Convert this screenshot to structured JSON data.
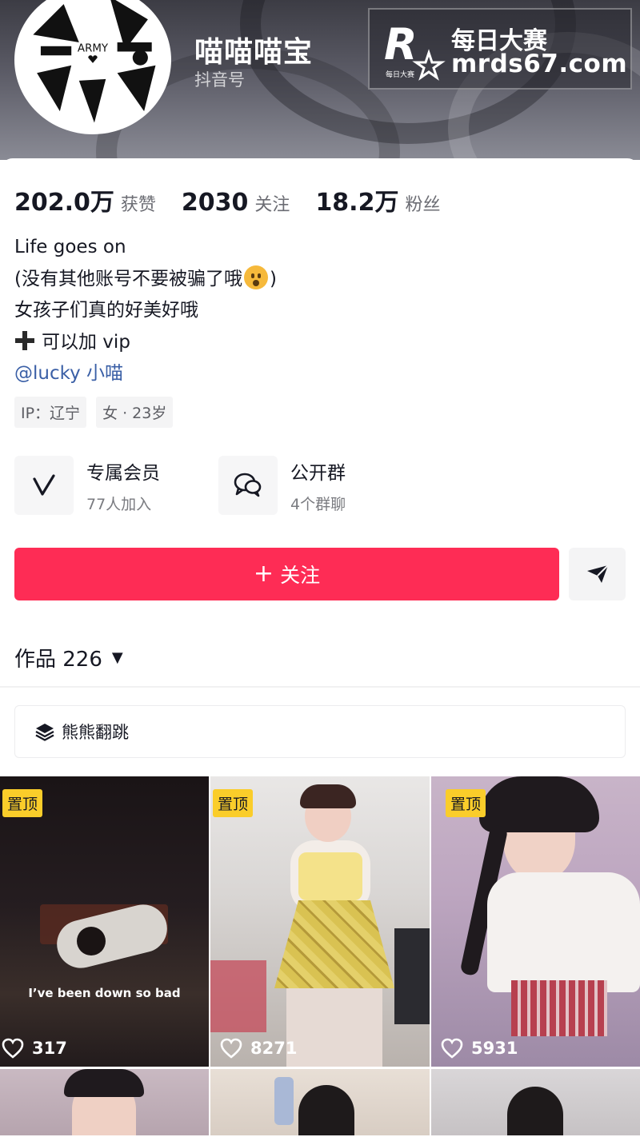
{
  "profile": {
    "nickname": "喵喵喵宝",
    "douyin_id_label": "抖音号",
    "avatar_text": "ARMY"
  },
  "watermark": {
    "logo_text": "每日大赛",
    "title": "每日大赛",
    "url": "mrds67.com"
  },
  "stats": [
    {
      "value": "202.0万",
      "label": "获赞"
    },
    {
      "value": "2030",
      "label": "关注"
    },
    {
      "value": "18.2万",
      "label": "粉丝"
    }
  ],
  "bio": {
    "line1": "Life goes on",
    "line2_pre": "(没有其他账号不要被骗了哦",
    "line2_post": ")",
    "line3": "女孩子们真的好美好哦",
    "line4": "可以加 vip",
    "mention": "@lucky 小喵"
  },
  "tags": [
    "IP：辽宁",
    "女 · 23岁"
  ],
  "features": [
    {
      "title": "专属会员",
      "sub": "77人加入",
      "icon": "v-member-icon"
    },
    {
      "title": "公开群",
      "sub": "4个群聊",
      "icon": "chat-group-icon"
    }
  ],
  "follow_label": "关注",
  "works": {
    "label": "作品 226"
  },
  "collection": {
    "label": "熊熊翻跳"
  },
  "videos": [
    {
      "pinned": "置顶",
      "likes": "317",
      "caption": "I’ve been down so bad"
    },
    {
      "pinned": "置顶",
      "likes": "8271"
    },
    {
      "pinned": "置顶",
      "likes": "5931"
    }
  ],
  "colors": {
    "follow": "#fe2c55",
    "pin": "#facd2a",
    "mention": "#3a5fa6"
  }
}
